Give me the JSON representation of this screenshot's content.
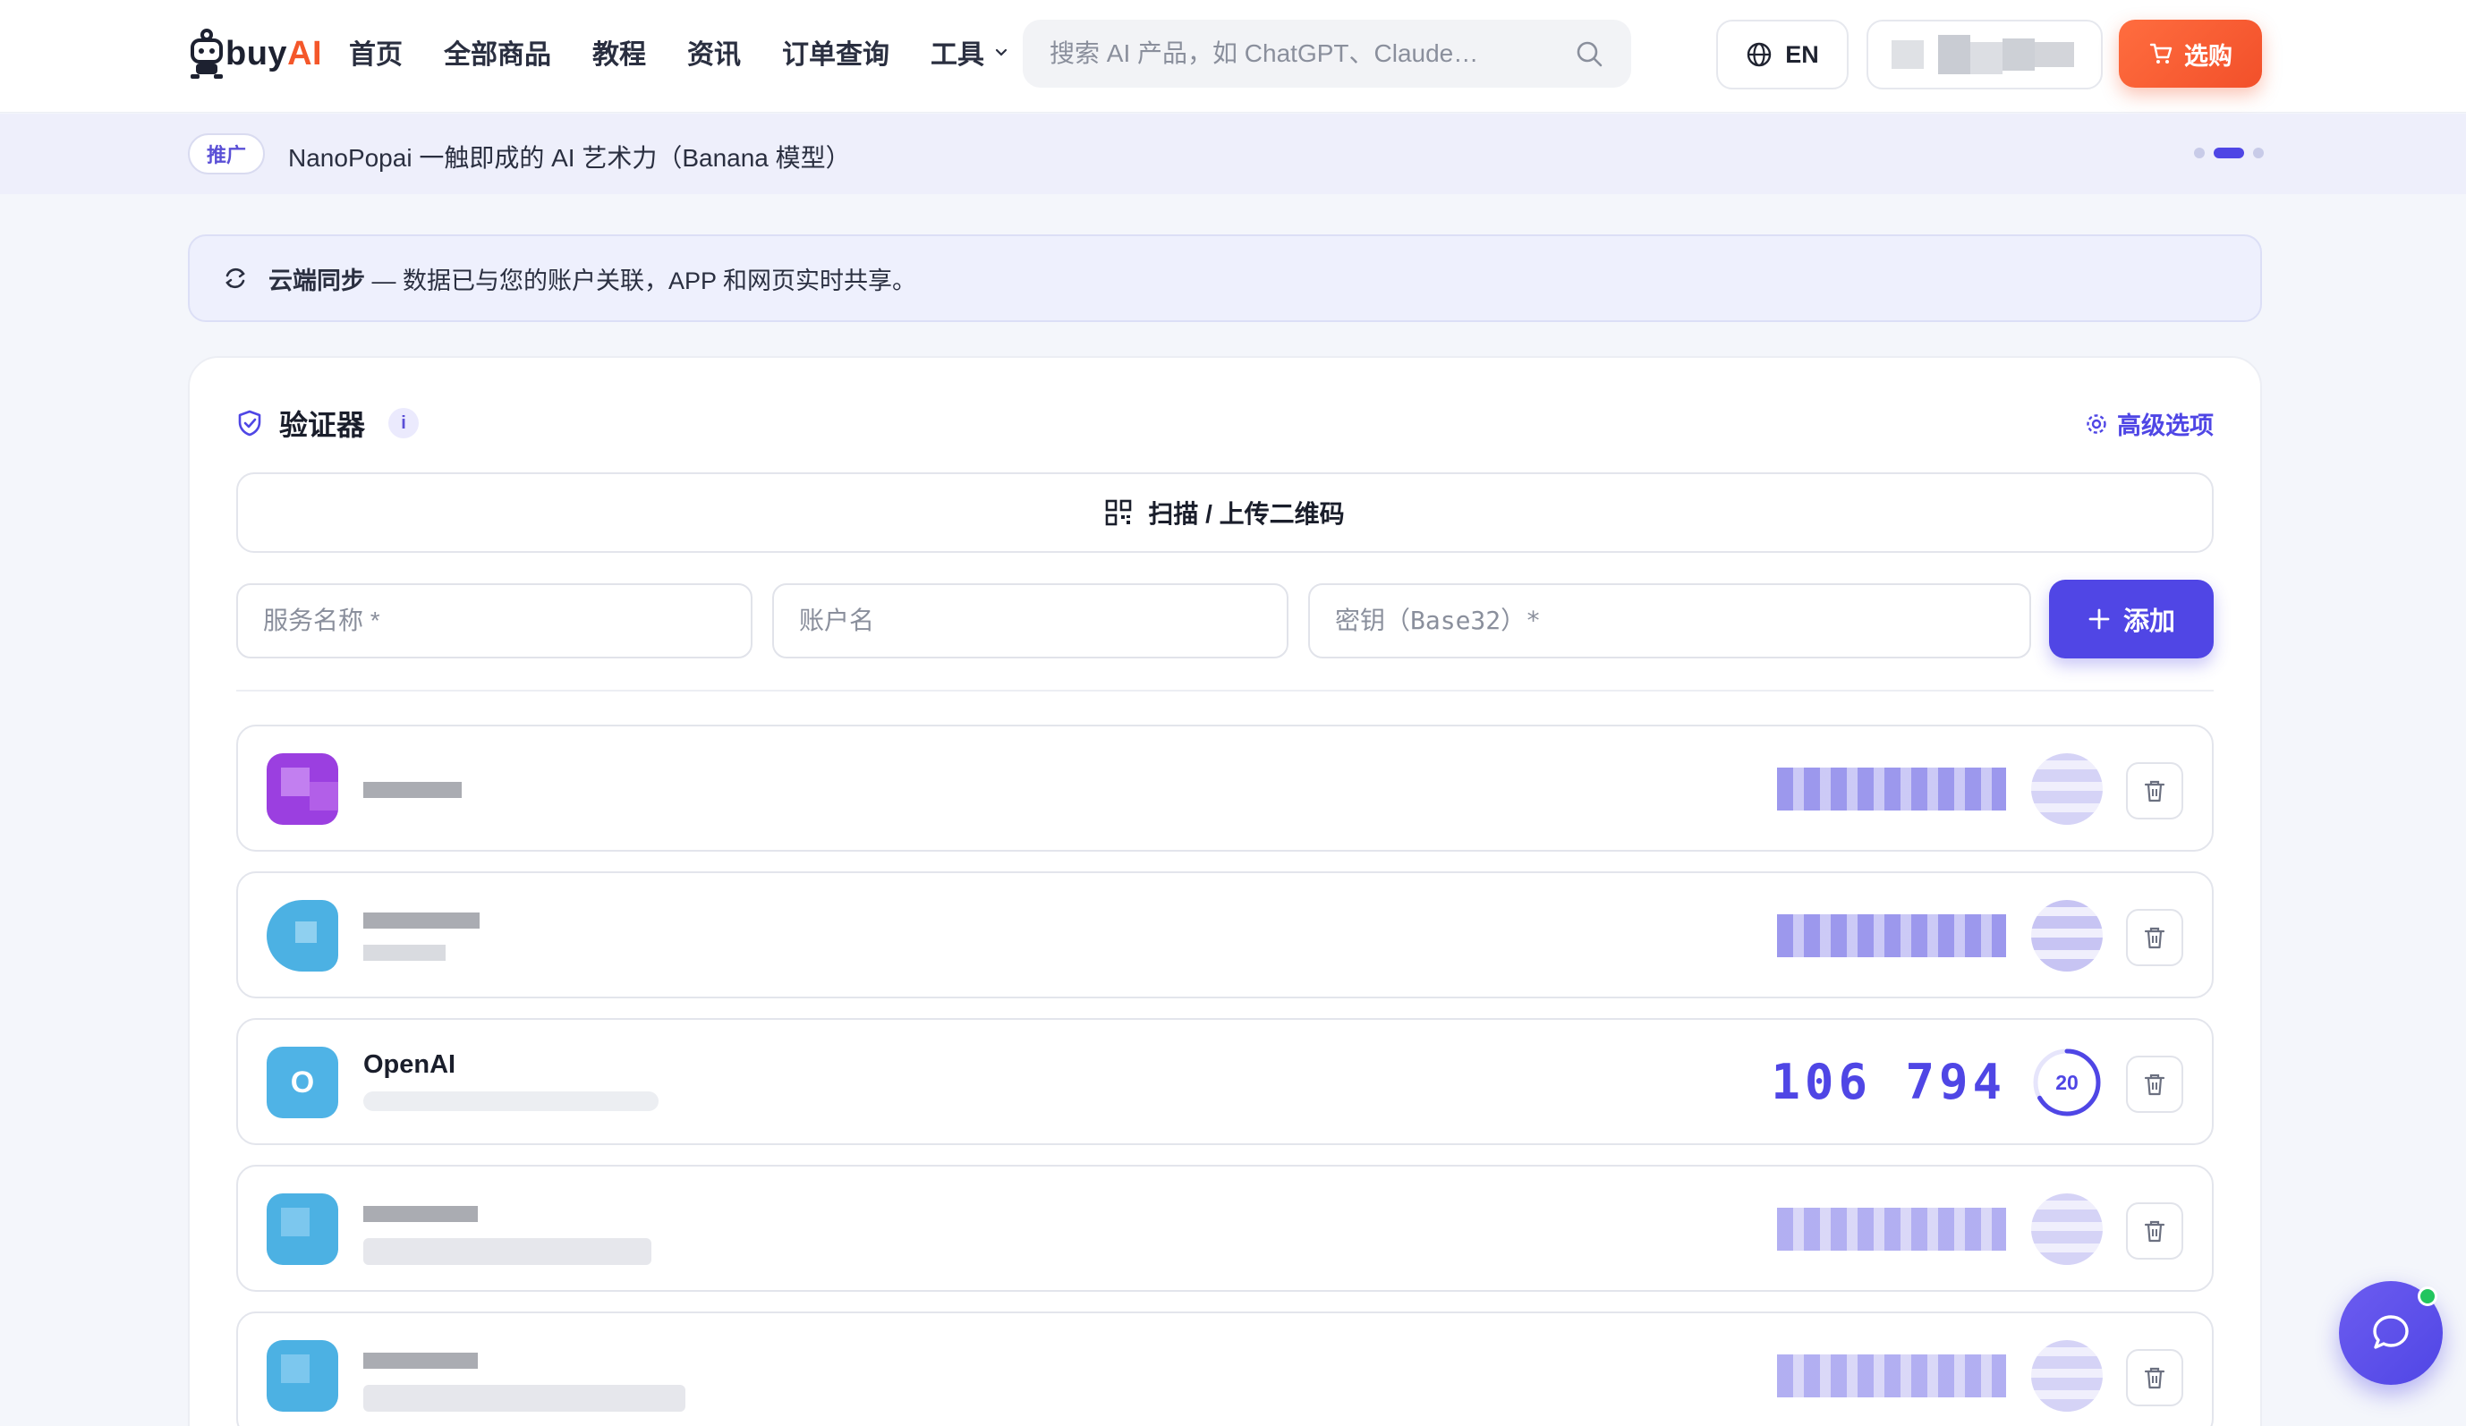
{
  "header": {
    "logo": {
      "buy": "buy",
      "ai": "AI"
    },
    "nav": [
      {
        "label": "首页"
      },
      {
        "label": "全部商品"
      },
      {
        "label": "教程"
      },
      {
        "label": "资讯"
      },
      {
        "label": "订单查询"
      },
      {
        "label": "工具"
      }
    ],
    "search": {
      "placeholder": "搜索 AI 产品，如 ChatGPT、Claude…"
    },
    "language": "EN",
    "buy_label": "选购"
  },
  "promo": {
    "tag": "推广",
    "text": "NanoPopai 一触即成的 AI 艺术力（Banana 模型）",
    "slide_active_index": 1,
    "slide_count": 3
  },
  "sync_notice": {
    "title": "云端同步",
    "text": " — 数据已与您的账户关联，APP 和网页实时共享。"
  },
  "authenticator": {
    "title": "验证器",
    "info_badge": "i",
    "advanced_label": "高级选项",
    "scan_label": "扫描 / 上传二维码",
    "form": {
      "service_placeholder": "服务名称 *",
      "account_placeholder": "账户名",
      "secret_placeholder": "密钥（Base32）*",
      "add_label": "添加"
    },
    "entries": [
      {
        "name": "",
        "code": "",
        "redacted": true
      },
      {
        "name": "",
        "code": "",
        "redacted": true
      },
      {
        "name": "OpenAI",
        "icon_letter": "O",
        "code": "106 794",
        "seconds_left": "20",
        "redacted": false
      },
      {
        "name": "",
        "code": "",
        "redacted": true
      },
      {
        "name": "",
        "code": "",
        "redacted": true
      }
    ]
  },
  "colors": {
    "accent": "#4f46e5",
    "brand_orange": "#f4572a",
    "online": "#22c55e"
  }
}
